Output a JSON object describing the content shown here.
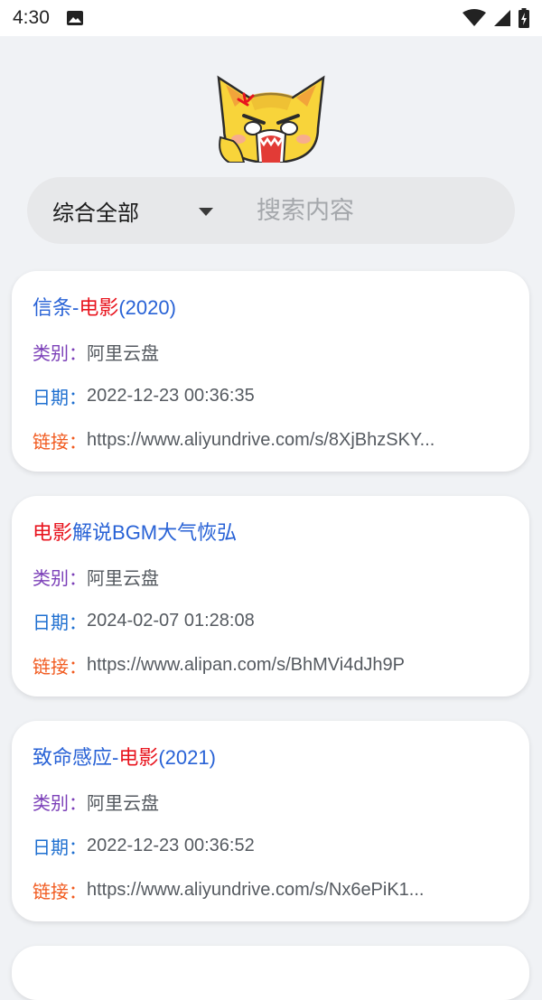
{
  "status_bar": {
    "time": "4:30"
  },
  "search": {
    "category": "综合全部",
    "placeholder": "搜索内容"
  },
  "labels": {
    "category": "类别：",
    "date": "日期：",
    "link": "链接："
  },
  "results": [
    {
      "title_parts": [
        "信条-",
        "电影",
        "(2020)"
      ],
      "category": "阿里云盘",
      "date": "2022-12-23 00:36:35",
      "link": "https://www.aliyundrive.com/s/8XjBhzSKY..."
    },
    {
      "title_parts": [
        "",
        "电影",
        "解说BGM大气恢弘"
      ],
      "category": "阿里云盘",
      "date": "2024-02-07 01:28:08",
      "link": "https://www.alipan.com/s/BhMVi4dJh9P"
    },
    {
      "title_parts": [
        "致命感应-",
        "电影",
        "(2021)"
      ],
      "category": "阿里云盘",
      "date": "2022-12-23 00:36:52",
      "link": "https://www.aliyundrive.com/s/Nx6ePiK1..."
    }
  ],
  "colors": {
    "title": "#2862d6",
    "highlight": "#e8141e",
    "category_label": "#7b3fb8",
    "date_label": "#1e6fd0",
    "link_label": "#f15a1f"
  }
}
